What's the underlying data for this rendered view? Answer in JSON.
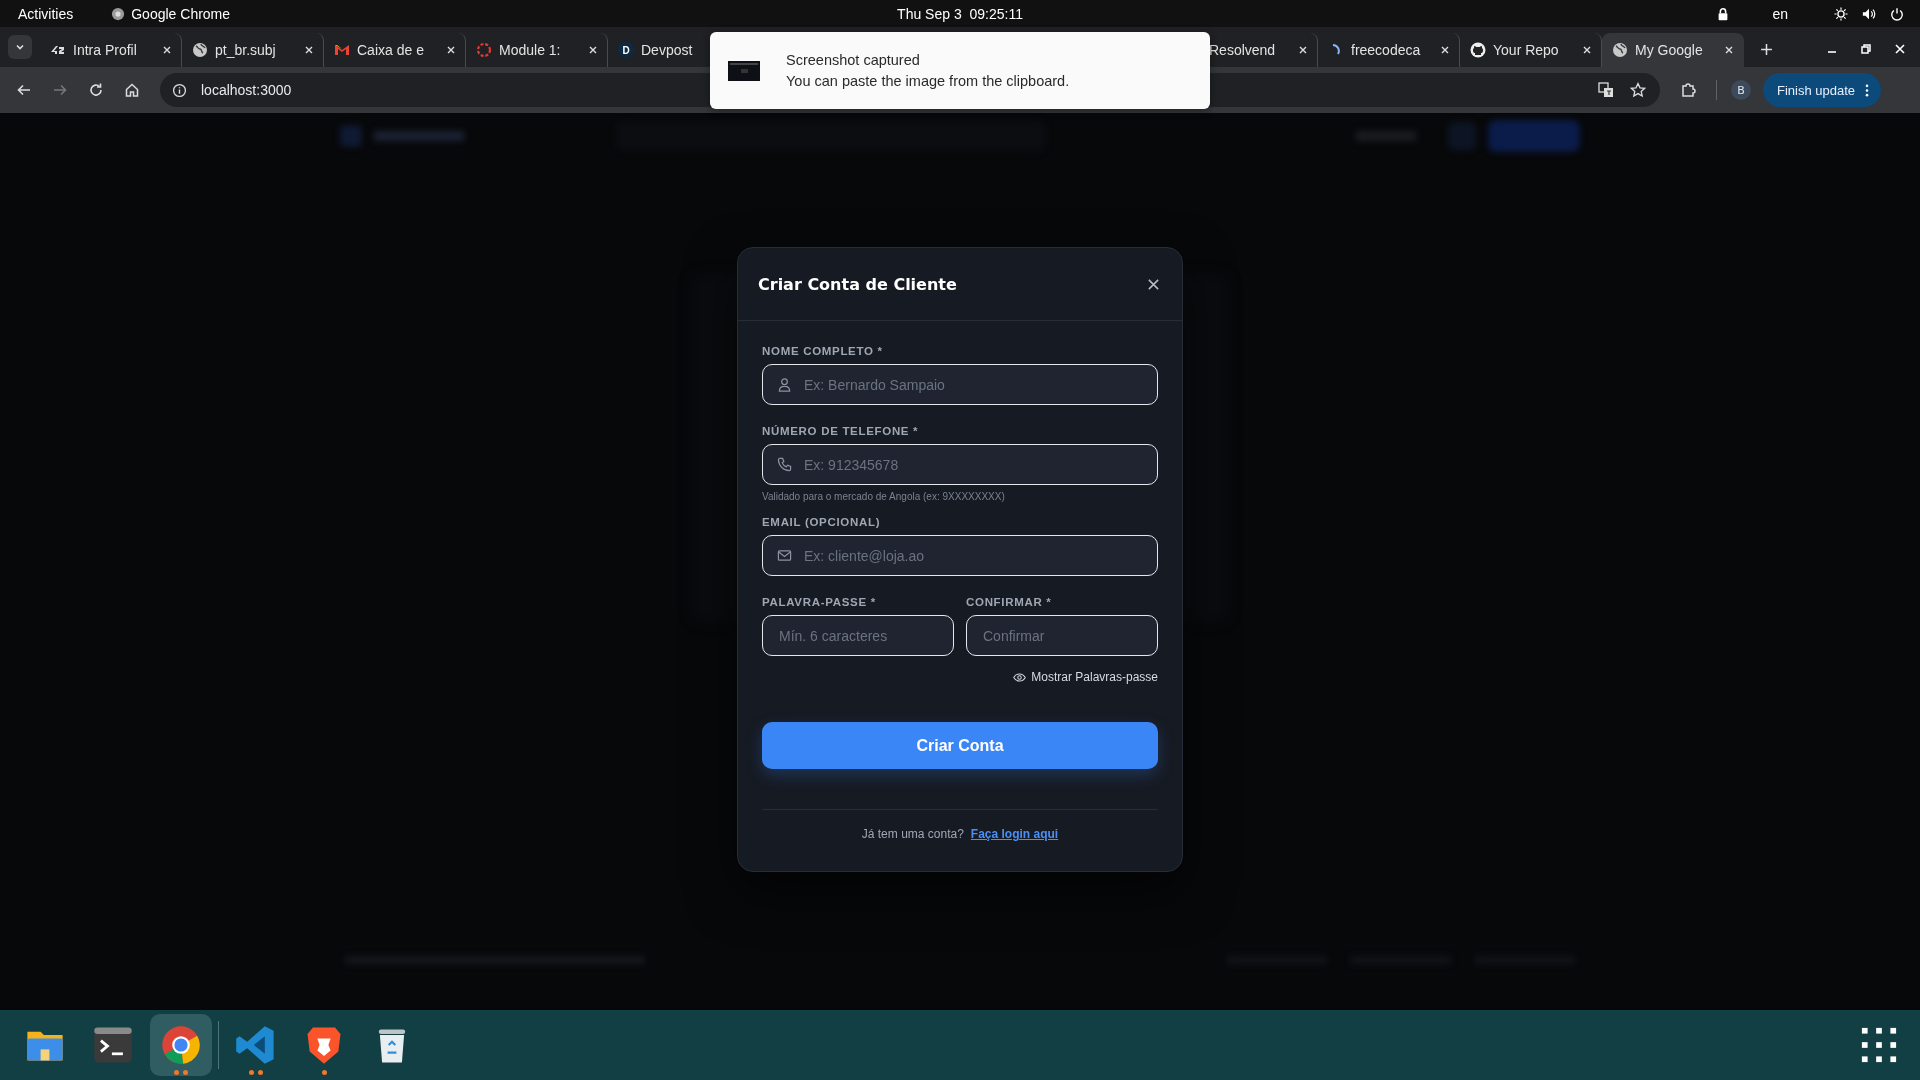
{
  "top_bar": {
    "activities": "Activities",
    "app_name": "Google Chrome",
    "clock": "Thu Sep 3  09:25:11",
    "language": "en"
  },
  "tabs": [
    {
      "title": "Intra Profil",
      "kind": "forty-two",
      "selected": false,
      "close_button": true
    },
    {
      "title": "pt_br.subj",
      "kind": "globe",
      "selected": false,
      "close_button": true
    },
    {
      "title": "Caixa de e",
      "kind": "mail",
      "selected": false,
      "close_button": true
    },
    {
      "title": "Module 1:",
      "kind": "ring",
      "selected": false,
      "close_button": true
    },
    {
      "title": "Devpost",
      "kind": "badge",
      "icon_text": "D",
      "selected": false
    },
    {
      "title": "Resolvend",
      "kind": "hidden",
      "selected": false,
      "close_button": true,
      "gap_before": true
    },
    {
      "title": "freecodeca",
      "kind": "spinner",
      "selected": false,
      "close_button": true
    },
    {
      "title": "Your Repo",
      "kind": "github",
      "selected": false,
      "close_button": true
    },
    {
      "title": "My Google",
      "kind": "globe",
      "selected": true,
      "close_button": true
    }
  ],
  "address_bar": {
    "url": "localhost:3000",
    "profile_initial": "B",
    "update_button": "Finish update"
  },
  "notification": {
    "title": "Screenshot captured",
    "body": "You can paste the image from the clipboard."
  },
  "modal": {
    "title": "Criar Conta de Cliente",
    "fields": [
      {
        "label": "NOME COMPLETO *",
        "placeholder": "Ex: Bernardo Sampaio",
        "kind": "person"
      },
      {
        "label": "NÚMERO DE TELEFONE *",
        "placeholder": "Ex: 912345678",
        "kind": "phone",
        "hint": "Validado para o mercado de Angola (ex: 9XXXXXXXX)"
      },
      {
        "label": "EMAIL (OPCIONAL)",
        "placeholder": "Ex: cliente@loja.ao",
        "kind": "mail"
      }
    ],
    "password_fields": [
      {
        "label": "PALAVRA-PASSE *",
        "placeholder": "Mín. 6 caracteres"
      },
      {
        "label": "CONFIRMAR *",
        "placeholder": "Confirmar"
      }
    ],
    "show_passwords": "Mostrar Palavras-passe",
    "submit": "Criar Conta",
    "footer_text": "Já tem uma conta?",
    "footer_link": "Faça login aqui"
  },
  "dock": [
    {
      "kind": "files",
      "selected": false,
      "running": false
    },
    {
      "kind": "terminal",
      "selected": false,
      "running": false
    },
    {
      "kind": "chrome",
      "selected": true,
      "running": true,
      "several_windows": true
    },
    {
      "kind": "vscode",
      "selected": false,
      "running": true,
      "several_windows": true
    },
    {
      "kind": "brave",
      "selected": false,
      "running": true,
      "several_windows": false
    },
    {
      "kind": "trash",
      "selected": false,
      "running": false
    }
  ]
}
